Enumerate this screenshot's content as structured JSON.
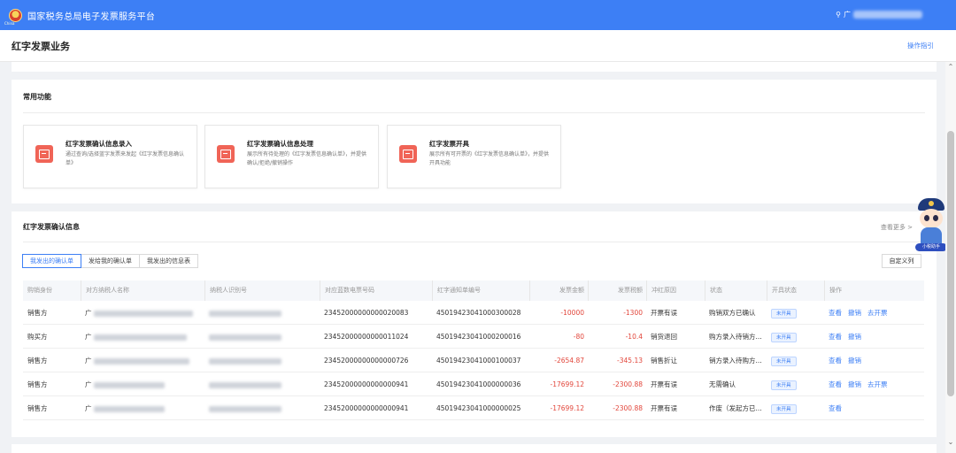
{
  "header": {
    "platform_title": "国家税务总局电子发票服务平台",
    "emblem_text": "China",
    "user_prefix": "广"
  },
  "page": {
    "title": "红字发票业务",
    "guide_link": "操作指引"
  },
  "common_functions": {
    "title": "常用功能",
    "items": [
      {
        "name": "红字发票确认信息录入",
        "desc": "通过查询/选择蓝字发票来发起《红字发票信息确认单》"
      },
      {
        "name": "红字发票确认信息处理",
        "desc": "展示所有待处理的《红字发票信息确认单》，并提供确认/拒绝/撤销操作"
      },
      {
        "name": "红字发票开具",
        "desc": "展示所有可开票的《红字发票信息确认单》，并提供开具功能"
      }
    ]
  },
  "confirm_info": {
    "title": "红字发票确认信息",
    "more": "查看更多 >",
    "tabs": [
      "我发出的确认单",
      "发给我的确认单",
      "我发出的信息表"
    ],
    "custom_columns": "自定义列",
    "columns": [
      "购销身份",
      "对方纳税人名称",
      "纳税人识别号",
      "对应蓝数电票号码",
      "红字通知单编号",
      "发票金额",
      "发票税额",
      "冲红原因",
      "状态",
      "开具状态",
      "操作"
    ],
    "rows": [
      {
        "role": "销售方",
        "name_prefix": "广",
        "blue_no": "23452000000000020083",
        "red_no": "45019423041000300028",
        "amount": "-10000",
        "tax": "-1300",
        "reason": "开票有误",
        "status": "购销双方已确认",
        "issue_status": "未开具",
        "ops": [
          "查看",
          "撤销",
          "去开票"
        ]
      },
      {
        "role": "购买方",
        "name_prefix": "广",
        "blue_no": "23452000000000011024",
        "red_no": "45019423041000200016",
        "amount": "-80",
        "tax": "-10.4",
        "reason": "销货退回",
        "status": "购方录入待销方...",
        "issue_status": "未开具",
        "ops": [
          "查看",
          "撤销"
        ]
      },
      {
        "role": "销售方",
        "name_prefix": "广",
        "blue_no": "23452000000000000726",
        "red_no": "45019423041000100037",
        "amount": "-2654.87",
        "tax": "-345.13",
        "reason": "销售折让",
        "status": "销方录入待购方...",
        "issue_status": "未开具",
        "ops": [
          "查看",
          "撤销"
        ]
      },
      {
        "role": "销售方",
        "name_prefix": "广",
        "blue_no": "23452000000000000941",
        "red_no": "45019423041000000036",
        "amount": "-17699.12",
        "tax": "-2300.88",
        "reason": "开票有误",
        "status": "无需确认",
        "issue_status": "未开具",
        "ops": [
          "查看",
          "撤销",
          "去开票"
        ]
      },
      {
        "role": "销售方",
        "name_prefix": "广",
        "blue_no": "23452000000000000941",
        "red_no": "45019423041000000025",
        "amount": "-17699.12",
        "tax": "-2300.88",
        "reason": "开票有误",
        "status": "作废（发起方已...",
        "issue_status": "未开具",
        "ops": [
          "查看"
        ]
      }
    ]
  },
  "mascot": {
    "banner": "小税助手"
  },
  "colors": {
    "primary": "#3d7ff5",
    "danger": "#e2463b",
    "icon_red": "#f06457"
  }
}
